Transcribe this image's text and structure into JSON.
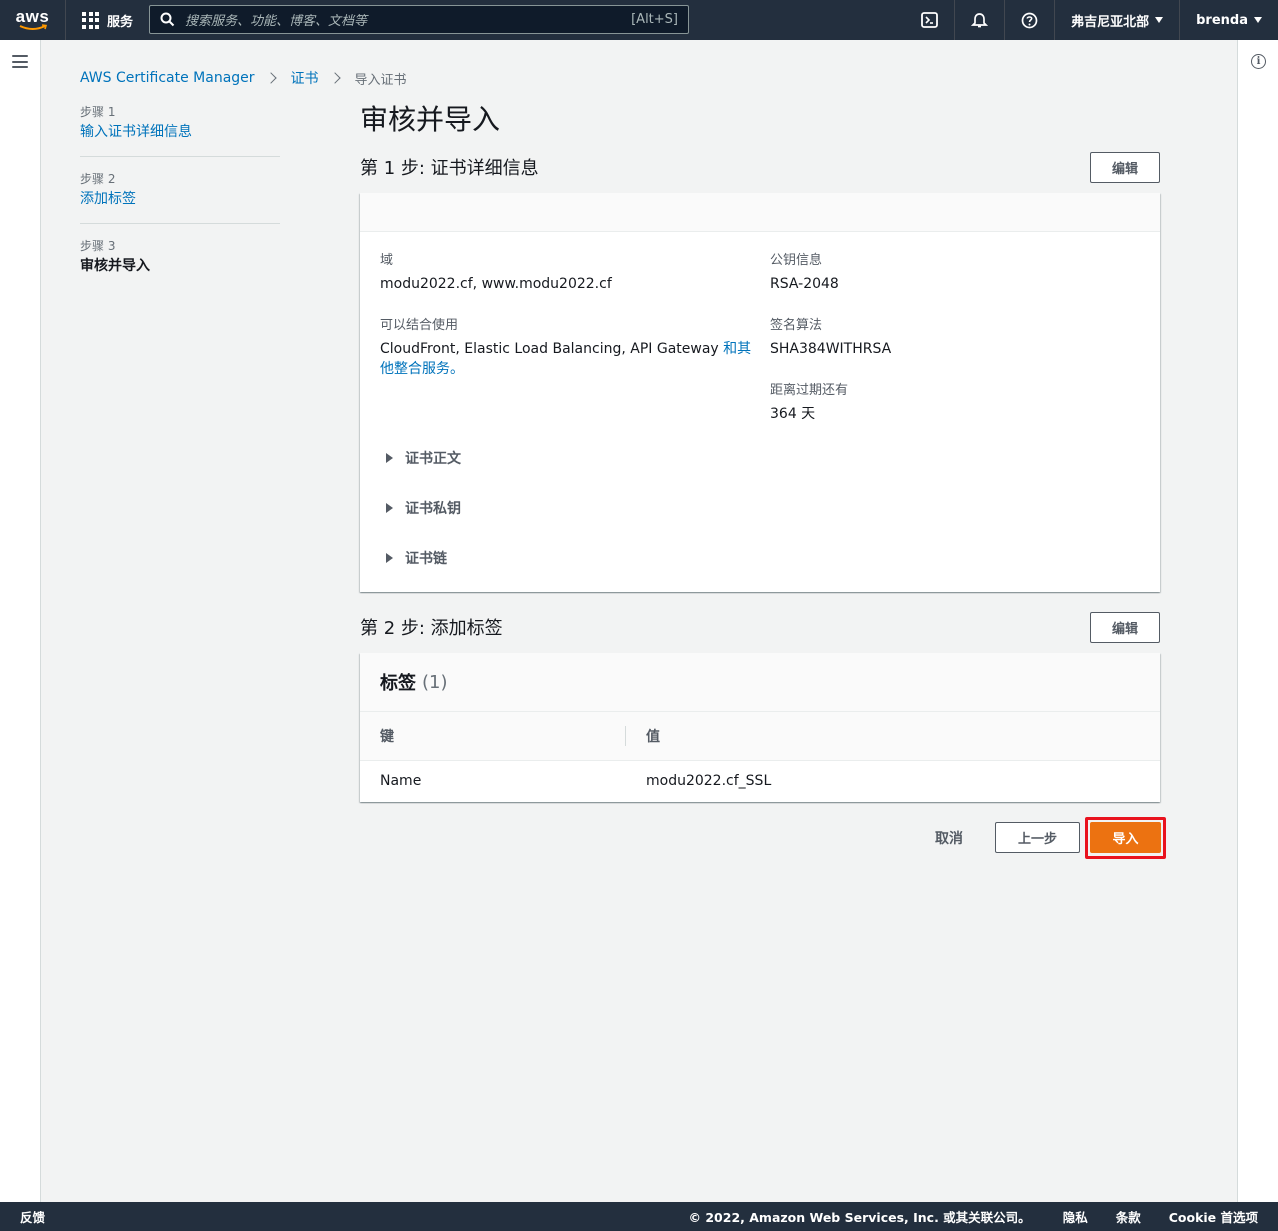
{
  "topnav": {
    "logo": "aws",
    "services_label": "服务",
    "search_placeholder": "搜索服务、功能、博客、文档等",
    "search_shortcut": "[Alt+S]",
    "region": "弗吉尼亚北部",
    "user": "brenda",
    "icons": [
      "cloudshell-icon",
      "bell-icon",
      "help-icon"
    ]
  },
  "breadcrumb": {
    "items": [
      "AWS Certificate Manager",
      "证书"
    ],
    "current": "导入证书"
  },
  "steps": [
    {
      "num": "步骤 1",
      "label": "输入证书详细信息"
    },
    {
      "num": "步骤 2",
      "label": "添加标签"
    },
    {
      "num": "步骤 3",
      "label": "审核并导入"
    }
  ],
  "page_title": "审核并导入",
  "section1": {
    "title": "第 1 步: 证书详细信息",
    "edit": "编辑",
    "domain_label": "域",
    "domain_value": "modu2022.cf, www.modu2022.cf",
    "usable_label": "可以结合使用",
    "usable_value": "CloudFront, Elastic Load Balancing, API Gateway ",
    "usable_link": "和其他整合服务。",
    "pubkey_label": "公钥信息",
    "pubkey_value": "RSA-2048",
    "sigalg_label": "签名算法",
    "sigalg_value": "SHA384WITHRSA",
    "expiry_label": "距离过期还有",
    "expiry_value": "364 天",
    "expanders": [
      "证书正文",
      "证书私钥",
      "证书链"
    ]
  },
  "section2": {
    "title": "第 2 步: 添加标签",
    "edit": "编辑",
    "tags_title": "标签",
    "tags_count": "(1)",
    "col_key": "键",
    "col_value": "值",
    "rows": [
      {
        "key": "Name",
        "value": "modu2022.cf_SSL"
      }
    ]
  },
  "actions": {
    "cancel": "取消",
    "previous": "上一步",
    "import": "导入"
  },
  "footer": {
    "feedback": "反馈",
    "copyright": "© 2022, Amazon Web Services, Inc. 或其关联公司。",
    "privacy": "隐私",
    "terms": "条款",
    "cookie": "Cookie 首选项"
  },
  "colors": {
    "nav_bg": "#232f3e",
    "link": "#0073bb",
    "primary": "#ec7211",
    "highlight": "#e9121e"
  }
}
